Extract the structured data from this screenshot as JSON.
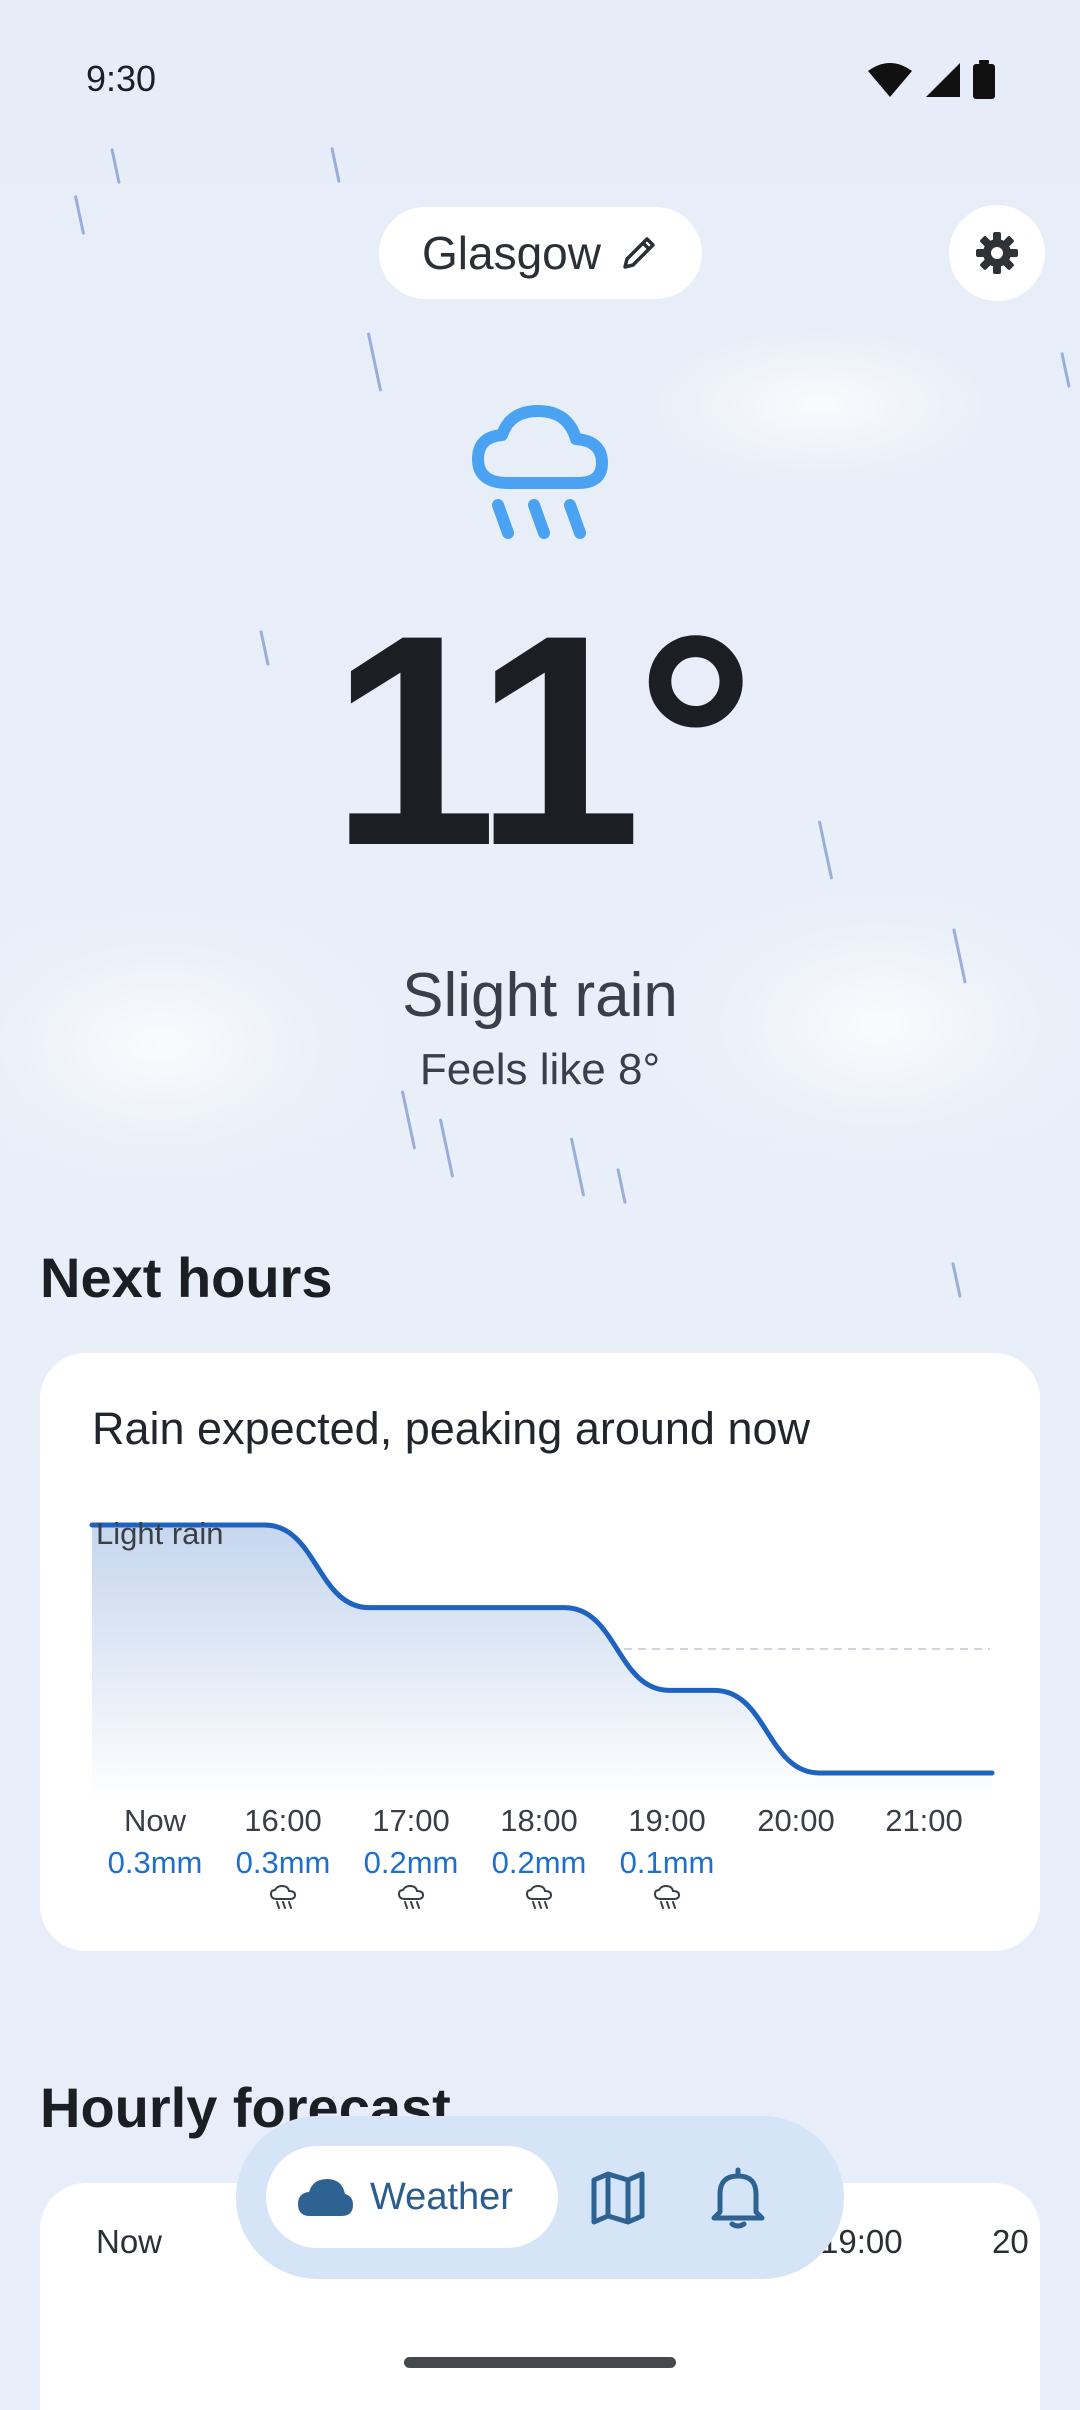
{
  "status_bar": {
    "time": "9:30"
  },
  "header": {
    "location": "Glasgow"
  },
  "current": {
    "temperature": "11°",
    "condition": "Slight rain",
    "feels_like": "Feels like 8°"
  },
  "next_hours": {
    "title": "Next hours",
    "summary": "Rain expected, peaking around now",
    "level_label": "Light rain",
    "ticks": [
      {
        "time": "Now",
        "amount": "0.3mm",
        "icon": "rain-icon",
        "show_icon": false
      },
      {
        "time": "16:00",
        "amount": "0.3mm",
        "icon": "rain-icon",
        "show_icon": true
      },
      {
        "time": "17:00",
        "amount": "0.2mm",
        "icon": "rain-icon",
        "show_icon": true
      },
      {
        "time": "18:00",
        "amount": "0.2mm",
        "icon": "rain-icon",
        "show_icon": true
      },
      {
        "time": "19:00",
        "amount": "0.1mm",
        "icon": "rain-icon",
        "show_icon": true
      },
      {
        "time": "20:00",
        "amount": ""
      },
      {
        "time": "21:00",
        "amount": ""
      }
    ]
  },
  "chart_data": {
    "type": "area",
    "title": "",
    "ylabel": "",
    "xlabel": "",
    "categories": [
      "Now",
      "16:00",
      "17:00",
      "18:00",
      "19:00",
      "20:00",
      "21:00"
    ],
    "series": [
      {
        "values": [
          0.3,
          0.3,
          0.2,
          0.2,
          0.1,
          0.0,
          0.0
        ]
      }
    ],
    "grid": false,
    "color": "#1f63c1"
  },
  "hourly": {
    "title": "Hourly forecast",
    "columns": [
      "Now",
      "19:00",
      "20"
    ]
  },
  "nav": {
    "weather_label": "Weather",
    "map_icon": "map-icon",
    "bell_icon": "bell-icon"
  },
  "colors": {
    "accent": "#1f6fce",
    "icon_blue": "#4aa3f2",
    "background": "#e8eef9"
  }
}
